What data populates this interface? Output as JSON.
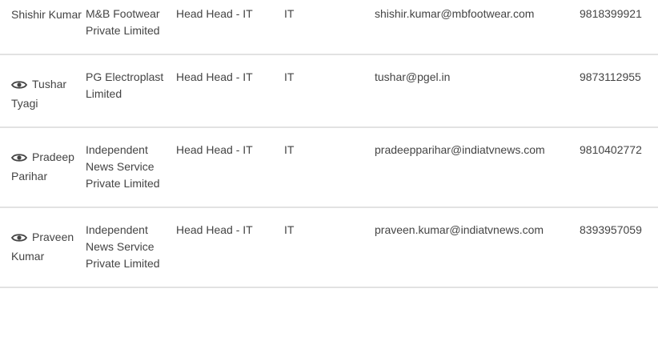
{
  "rows": [
    {
      "name": "Shishir Kumar",
      "has_view": false,
      "company": "M&B Footwear Private Limited",
      "designation": "Head Head - IT",
      "department": "IT",
      "email": "shishir.kumar@mbfootwear.com",
      "phone": "9818399921"
    },
    {
      "name": "Tushar Tyagi",
      "has_view": true,
      "company": "PG Electroplast Limited",
      "designation": "Head Head - IT",
      "department": "IT",
      "email": "tushar@pgel.in",
      "phone": "9873112955"
    },
    {
      "name": "Pradeep Parihar",
      "has_view": true,
      "company": "Independent News Service Private Limited",
      "designation": "Head Head - IT",
      "department": "IT",
      "email": "pradeepparihar@indiatvnews.com",
      "phone": "9810402772"
    },
    {
      "name": "Praveen Kumar",
      "has_view": true,
      "company": "Independent News Service Private Limited",
      "designation": "Head Head - IT",
      "department": "IT",
      "email": "praveen.kumar@indiatvnews.com",
      "phone": "8393957059"
    }
  ]
}
